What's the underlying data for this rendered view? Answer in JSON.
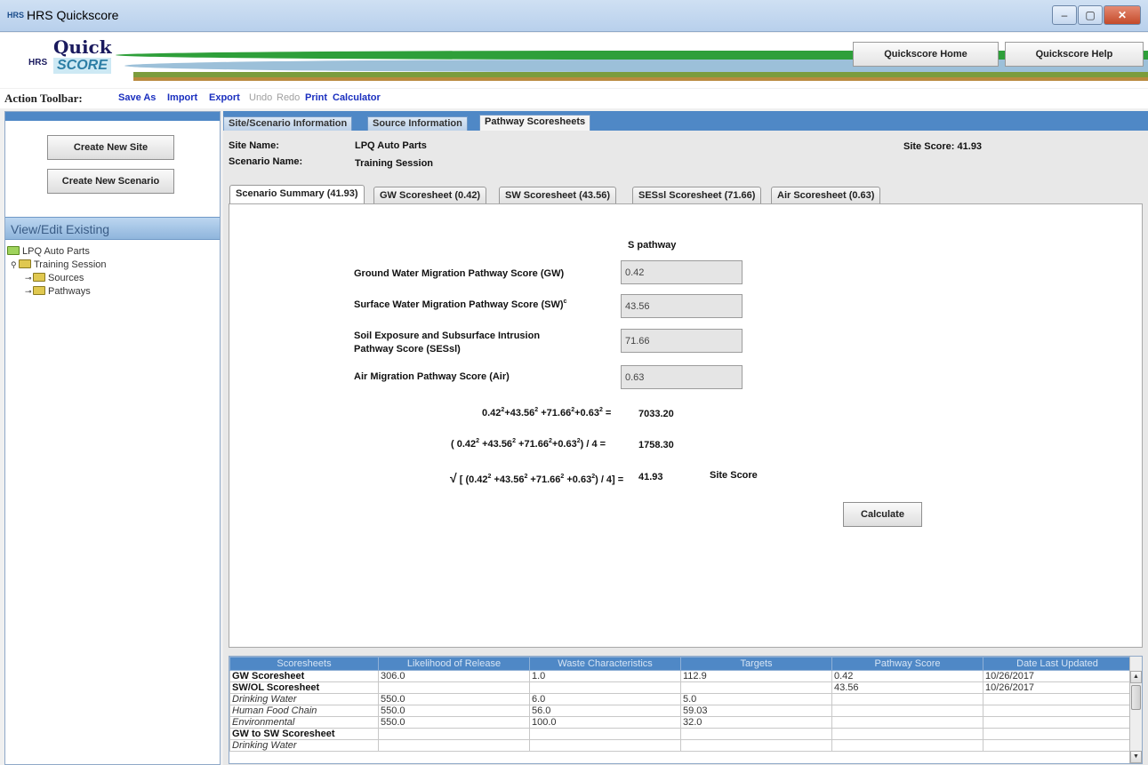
{
  "window": {
    "title": "HRS Quickscore",
    "app_icon_text": "HRS",
    "controls": [
      "–",
      "▢",
      "✕"
    ]
  },
  "banner": {
    "logo": {
      "quick": "Quick",
      "hrs": "HRS",
      "score": "SCORE"
    },
    "home_label": "Quickscore Home",
    "help_label": "Quickscore Help"
  },
  "toolbar": {
    "label": "Action Toolbar:",
    "actions": [
      {
        "label": "Save As",
        "enabled": true
      },
      {
        "label": "Import",
        "enabled": true
      },
      {
        "label": "Export",
        "enabled": true
      },
      {
        "label": "Undo",
        "enabled": false
      },
      {
        "label": "Redo",
        "enabled": false
      },
      {
        "label": "Print",
        "enabled": true
      },
      {
        "label": "Calculator",
        "enabled": true
      }
    ]
  },
  "left": {
    "create_site": "Create New Site",
    "create_scenario": "Create New Scenario",
    "view_edit": "View/Edit Existing",
    "tree": [
      {
        "label": "LPQ Auto Parts",
        "level": 0
      },
      {
        "label": "Training Session",
        "level": 1
      },
      {
        "label": "Sources",
        "level": 2
      },
      {
        "label": "Pathways",
        "level": 2
      }
    ]
  },
  "outer_tabs": [
    "Site/Scenario Information",
    "Source Information",
    "Pathway Scoresheets"
  ],
  "site": {
    "site_name_label": "Site Name:",
    "site_name": "LPQ Auto Parts",
    "scenario_name_label": "Scenario Name:",
    "scenario_name": "Training Session",
    "site_score": "Site Score: 41.93"
  },
  "inner_tabs": [
    "Scenario Summary (41.93)",
    "GW Scoresheet (0.42)",
    "SW Scoresheet (43.56)",
    "SESsl Scoresheet (71.66)",
    "Air Scoresheet (0.63)"
  ],
  "summary": {
    "column_header": "S pathway",
    "rows": [
      {
        "label": "Ground Water Migration Pathway Score (GW)",
        "value": "0.42"
      },
      {
        "label": "Surface Water Migration Pathway Score (SW)",
        "label_sup": "c",
        "value": "43.56"
      },
      {
        "label": "Soil Exposure and Subsurface Intrusion",
        "label2": "Pathway Score (SESsl)",
        "value": "71.66"
      },
      {
        "label": "Air Migration Pathway Score (Air)",
        "value": "0.63"
      }
    ],
    "sum_squares_value": "7033.20",
    "avg_value": "1758.30",
    "root_value": "41.93",
    "site_score_label": "Site Score",
    "calculate_label": "Calculate"
  },
  "table": {
    "headers": [
      "Scoresheets",
      "Likelihood of Release",
      "Waste Characteristics",
      "Targets",
      "Pathway Score",
      "Date Last Updated"
    ],
    "rows": [
      {
        "style": "bold",
        "cells": [
          "GW Scoresheet",
          "306.0",
          "1.0",
          "112.9",
          "0.42",
          "10/26/2017"
        ]
      },
      {
        "style": "bold",
        "cells": [
          "SW/OL Scoresheet",
          "",
          "",
          "",
          "43.56",
          "10/26/2017"
        ]
      },
      {
        "style": "ital",
        "cells": [
          "Drinking Water",
          "550.0",
          "6.0",
          "5.0",
          "",
          ""
        ]
      },
      {
        "style": "ital",
        "cells": [
          "Human Food Chain",
          "550.0",
          "56.0",
          "59.03",
          "",
          ""
        ]
      },
      {
        "style": "ital",
        "cells": [
          "Environmental",
          "550.0",
          "100.0",
          "32.0",
          "",
          ""
        ]
      },
      {
        "style": "bold",
        "cells": [
          "GW to SW Scoresheet",
          "",
          "",
          "",
          "",
          ""
        ]
      },
      {
        "style": "ital",
        "cells": [
          "Drinking Water",
          "",
          "",
          "",
          "",
          ""
        ]
      }
    ]
  }
}
